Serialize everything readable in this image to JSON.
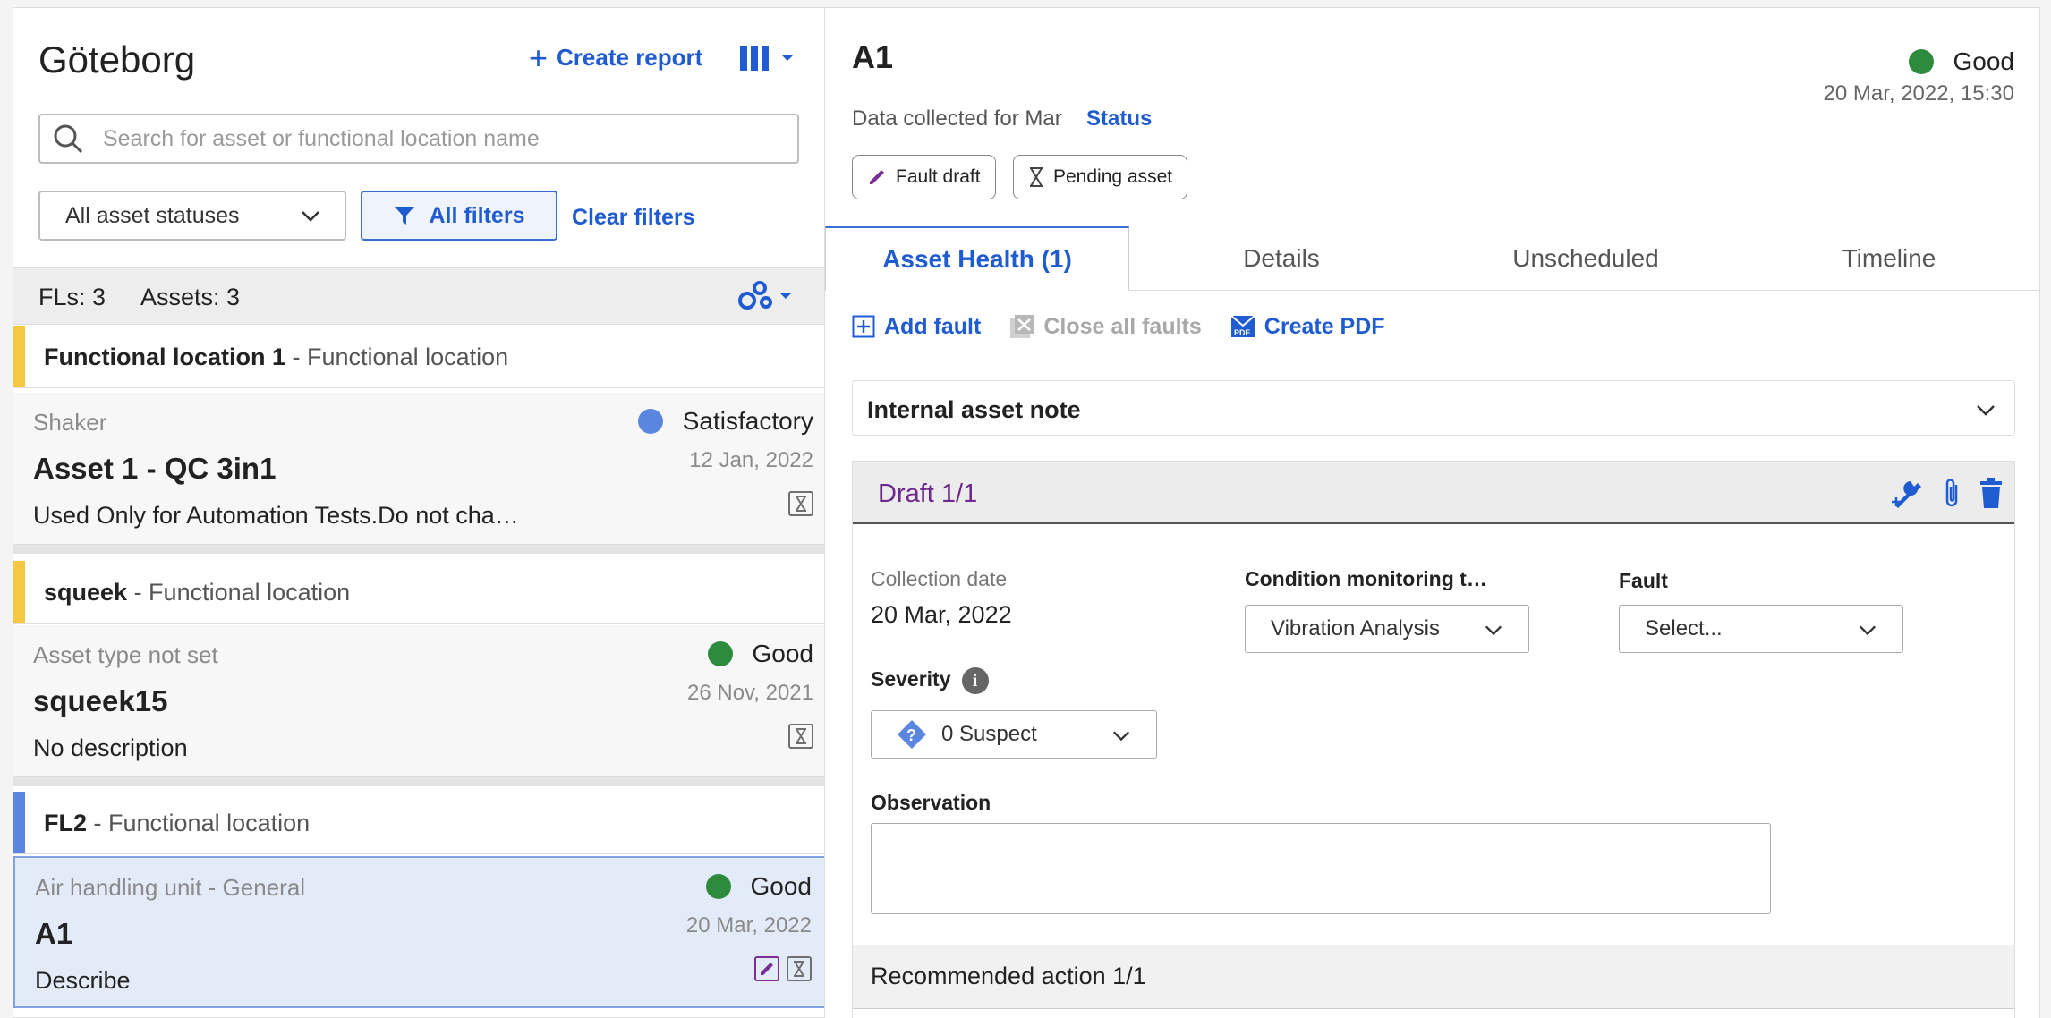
{
  "left": {
    "title": "Göteborg",
    "create_report": "Create report",
    "search_placeholder": "Search for asset or functional location name",
    "status_filter": "All asset statuses",
    "all_filters": "All filters",
    "clear_filters": "Clear filters",
    "fls_count": "FLs: 3",
    "assets_count": "Assets: 3",
    "groups": [
      {
        "fl_name": "Functional location 1",
        "fl_suffix": " - Functional location",
        "accent": "#f5c842",
        "asset": {
          "type": "Shaker",
          "name": "Asset 1 - QC 3in1",
          "description": "Used Only for Automation Tests.Do not cha…",
          "status": "Satisfactory",
          "status_color": "#5b86e0",
          "date": "12 Jan, 2022"
        }
      },
      {
        "fl_name": "squeek",
        "fl_suffix": " - Functional location",
        "accent": "#f5c842",
        "asset": {
          "type": "Asset type not set",
          "name": "squeek15",
          "description": "No description",
          "status": "Good",
          "status_color": "#2e8b3e",
          "date": "26 Nov, 2021"
        }
      },
      {
        "fl_name": "FL2",
        "fl_suffix": " - Functional location",
        "accent": "#5b86e0",
        "asset": {
          "type": "Air handling unit - General",
          "name": "A1",
          "description": "Describe",
          "status": "Good",
          "status_color": "#2e8b3e",
          "date": "20 Mar, 2022"
        }
      }
    ]
  },
  "right": {
    "title": "A1",
    "status": "Good",
    "status_color": "#2e8b3e",
    "date": "20 Mar, 2022, 15:30",
    "collected": "Data collected for Mar",
    "status_link": "Status",
    "chips": [
      "Fault draft",
      "Pending asset"
    ],
    "tabs": [
      "Asset Health (1)",
      "Details",
      "Unscheduled",
      "Timeline"
    ],
    "toolbar": {
      "add_fault": "Add fault",
      "close_all": "Close all faults",
      "create_pdf": "Create PDF"
    },
    "internal_note": "Internal asset note",
    "draft": {
      "title": "Draft 1/1",
      "collection_date_label": "Collection date",
      "collection_date": "20 Mar, 2022",
      "cm_label": "Condition monitoring t…",
      "cm_value": "Vibration Analysis",
      "fault_label": "Fault",
      "fault_value": "Select...",
      "severity_label": "Severity",
      "severity_value": "0 Suspect",
      "observation_label": "Observation",
      "observation_value": "",
      "recommended": "Recommended action 1/1"
    }
  }
}
